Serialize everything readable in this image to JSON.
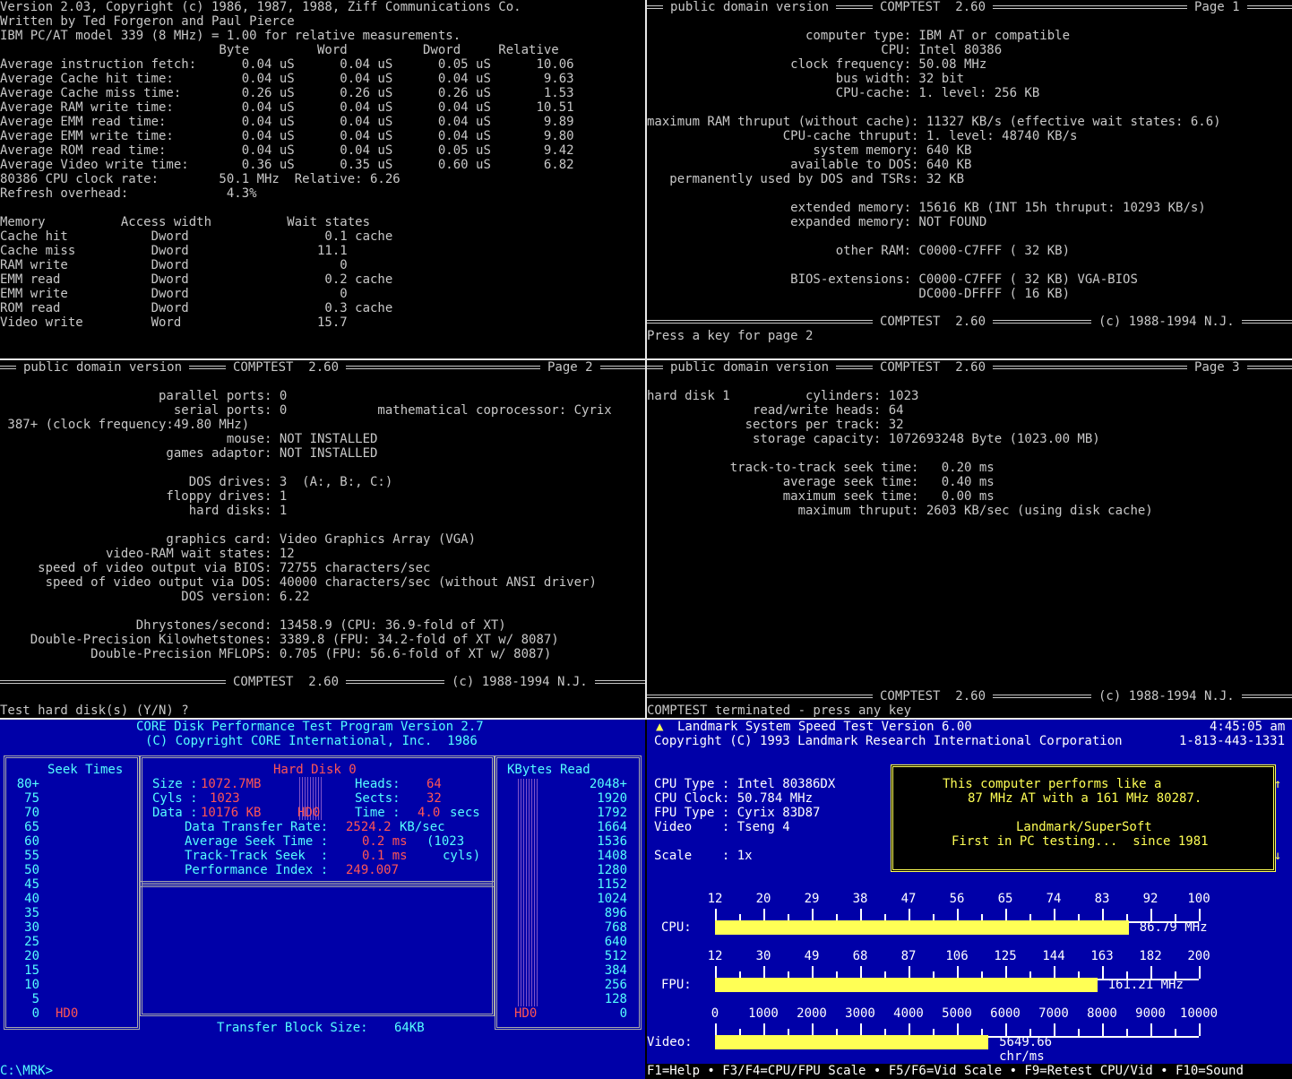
{
  "q1": {
    "lines": [
      "Version 2.03, Copyright (c) 1986, 1987, 1988, Ziff Communications Co.",
      "Written by Ted Forgeron and Paul Pierce",
      "IBM PC/AT model 339 (8 MHz) = 1.00 for relative measurements.",
      "                             Byte         Word          Dword     Relative",
      "Average instruction fetch:      0.04 uS      0.04 uS      0.05 uS      10.06",
      "Average Cache hit time:         0.04 uS      0.04 uS      0.04 uS       9.63",
      "Average Cache miss time:        0.26 uS      0.26 uS      0.26 uS       1.53",
      "Average RAM write time:         0.04 uS      0.04 uS      0.04 uS      10.51",
      "Average EMM read time:          0.04 uS      0.04 uS      0.04 uS       9.89",
      "Average EMM write time:         0.04 uS      0.04 uS      0.04 uS       9.80",
      "Average ROM read time:          0.04 uS      0.04 uS      0.05 uS       9.42",
      "Average Video write time:       0.36 uS      0.35 uS      0.60 uS       6.82",
      "80386 CPU clock rate:        50.1 MHz  Relative: 6.26",
      "Refresh overhead:             4.3%",
      "",
      "Memory          Access width          Wait states",
      "Cache hit           Dword                  0.1 cache",
      "Cache miss          Dword                 11.1",
      "RAM write           Dword                    0",
      "EMM read            Dword                  0.2 cache",
      "EMM write           Dword                    0",
      "ROM read            Dword                  0.3 cache",
      "Video write         Word                  15.7"
    ]
  },
  "q2": {
    "header_left": "public domain version",
    "header_mid": "COMPTEST  2.60",
    "header_right": "Page 1",
    "lines": [
      "",
      "                     computer type: IBM AT or compatible",
      "                               CPU: Intel 80386",
      "                   clock frequency: 50.08 MHz",
      "                         bus width: 32 bit",
      "                         CPU-cache: 1. level: 256 KB",
      "",
      "maximum RAM thruput (without cache): 11327 KB/s (effective wait states: 6.6)",
      "                  CPU-cache thruput: 1. level: 48740 KB/s",
      "                      system memory: 640 KB",
      "                   available to DOS: 640 KB",
      "   permanently used by DOS and TSRs: 32 KB",
      "",
      "                   extended memory: 15616 KB (INT 15h thruput: 10293 KB/s)",
      "                   expanded memory: NOT FOUND",
      "",
      "                         other RAM: C0000-C7FFF ( 32 KB)",
      "",
      "                   BIOS-extensions: C0000-C7FFF ( 32 KB) VGA-BIOS",
      "                                    DC000-DFFFF ( 16 KB)"
    ],
    "footer_mid": "COMPTEST  2.60",
    "footer_right": "(c) 1988-1994 N.J.",
    "prompt": "Press a key for page 2"
  },
  "q3": {
    "header_left": "public domain version",
    "header_mid": "COMPTEST  2.60",
    "header_right": "Page 2",
    "lines": [
      "",
      "                     parallel ports: 0",
      "                       serial ports: 0            mathematical coprocessor: Cyrix",
      " 387+ (clock frequency:49.80 MHz)",
      "                              mouse: NOT INSTALLED",
      "                      games adaptor: NOT INSTALLED",
      "",
      "                         DOS drives: 3  (A:, B:, C:)",
      "                      floppy drives: 1",
      "                         hard disks: 1",
      "",
      "                      graphics card: Video Graphics Array (VGA)",
      "              video-RAM wait states: 12",
      "     speed of video output via BIOS: 72755 characters/sec",
      "      speed of video output via DOS: 40000 characters/sec (without ANSI driver)",
      "                        DOS version: 6.22",
      "",
      "                  Dhrystones/second: 13458.9 (CPU: 36.9-fold of XT)",
      "    Double-Precision Kilowhetstones: 3389.8 (FPU: 34.2-fold of XT w/ 8087)",
      "            Double-Precision MFLOPS: 0.705 (FPU: 56.6-fold of XT w/ 8087)"
    ],
    "footer_mid": "COMPTEST  2.60",
    "footer_right": "(c) 1988-1994 N.J.",
    "prompt": "Test hard disk(s) (Y/N) ?"
  },
  "q4": {
    "header_left": "public domain version",
    "header_mid": "COMPTEST  2.60",
    "header_right": "Page 3",
    "lines": [
      "hard disk 1          cylinders: 1023",
      "              read/write heads: 64",
      "             sectors per track: 32",
      "              storage capacity: 1072693248 Byte (1023.00 MB)",
      "",
      "           track-to-track seek time:   0.20 ms",
      "                  average seek time:   0.40 ms",
      "                  maximum seek time:   0.00 ms",
      "                    maximum thruput: 2603 KB/sec (using disk cache)"
    ],
    "footer_mid": "COMPTEST  2.60",
    "footer_right": "(c) 1988-1994 N.J.",
    "prompt": "COMPTEST terminated - press any key"
  },
  "core": {
    "title1": "CORE Disk Performance Test Program Version 2.7",
    "title2": "(C) Copyright CORE International, Inc.  1986",
    "seek_title": "Seek Times",
    "seek_labels": [
      "80+",
      "75",
      "70",
      "65",
      "60",
      "55",
      "50",
      "45",
      "40",
      "35",
      "30",
      "25",
      "20",
      "15",
      "10",
      "5",
      "0"
    ],
    "seek_drive": "HD0",
    "kb_title": "KBytes Read",
    "kb_labels": [
      "2048+",
      "1920",
      "1792",
      "1664",
      "1536",
      "1408",
      "1280",
      "1152",
      "1024",
      "896",
      "768",
      "640",
      "512",
      "384",
      "256",
      "128",
      "0"
    ],
    "kb_drive": "HD0",
    "disk_title": "Hard Disk 0",
    "size_label": "Size :",
    "size_value": "1072.7MB",
    "heads_label": "Heads:",
    "heads_value": "64",
    "cyls_label": "Cyls : ",
    "cyls_value": "1023",
    "sects_label": "Sects:",
    "sects_value": "32",
    "data_label": "Data :",
    "data_value": "10176 KB",
    "drive_label": "HD0",
    "time_label": "Time :",
    "time_value": "4.0",
    "time_unit": "secs",
    "dtr_label": "Data Transfer Rate:",
    "dtr_value": "2524.2",
    "dtr_unit": "KB/sec",
    "avg_label": "Average Seek Time :",
    "avg_value": "0.2 ms",
    "avg_note1": "(1023",
    "tt_label": "Track-Track Seek  :",
    "tt_value": "0.1 ms",
    "avg_note2": "cyls)",
    "pi_label": "Performance Index :",
    "pi_value": "249.007",
    "block_label": "Transfer Block Size:",
    "block_value": "64KB",
    "prompt": "C:\\MRK>"
  },
  "landmark": {
    "title1": "Landmark System Speed Test Version 6.00",
    "time": "4:45:05 am",
    "title2": "Copyright (C) 1993 Landmark Research International Corporation",
    "phone": "1-813-443-1331",
    "cpu_type": "CPU Type : Intel 80386DX",
    "cpu_clock": "CPU Clock: 50.784 MHz",
    "fpu_type": "FPU Type : Cyrix 83D87",
    "video": "Video    : Tseng 4",
    "scale": "Scale    : 1x",
    "msg1": "This computer performs like a",
    "msg2": "87 MHz AT with a 161 MHz 80287.",
    "msg3": "Landmark/SuperSoft",
    "msg4": "First in PC testing...  since 1981",
    "cpu_label": "CPU:",
    "cpu_ticks": [
      "12",
      "20",
      "29",
      "38",
      "47",
      "56",
      "65",
      "74",
      "83",
      "92",
      "100"
    ],
    "cpu_result": "86.79 MHz",
    "cpu_fraction": 0.855,
    "fpu_label": "FPU:",
    "fpu_ticks": [
      "12",
      "30",
      "49",
      "68",
      "87",
      "106",
      "125",
      "144",
      "163",
      "182",
      "200"
    ],
    "fpu_result": "161.21 MHz",
    "fpu_fraction": 0.79,
    "video_label": "Video:",
    "video_ticks": [
      "0",
      "1000",
      "2000",
      "3000",
      "4000",
      "5000",
      "6000",
      "7000",
      "8000",
      "9000",
      "10000"
    ],
    "video_result": "5649.66",
    "video_unit": "chr/ms",
    "video_fraction": 0.565,
    "footer": "F1=Help • F3/F4=CPU/FPU Scale • F5/F6=Vid Scale • F9=Retest CPU/Vid • F10=Sound",
    "arrow_up": "↑",
    "arrow_down": "↓",
    "logo": "▲"
  }
}
